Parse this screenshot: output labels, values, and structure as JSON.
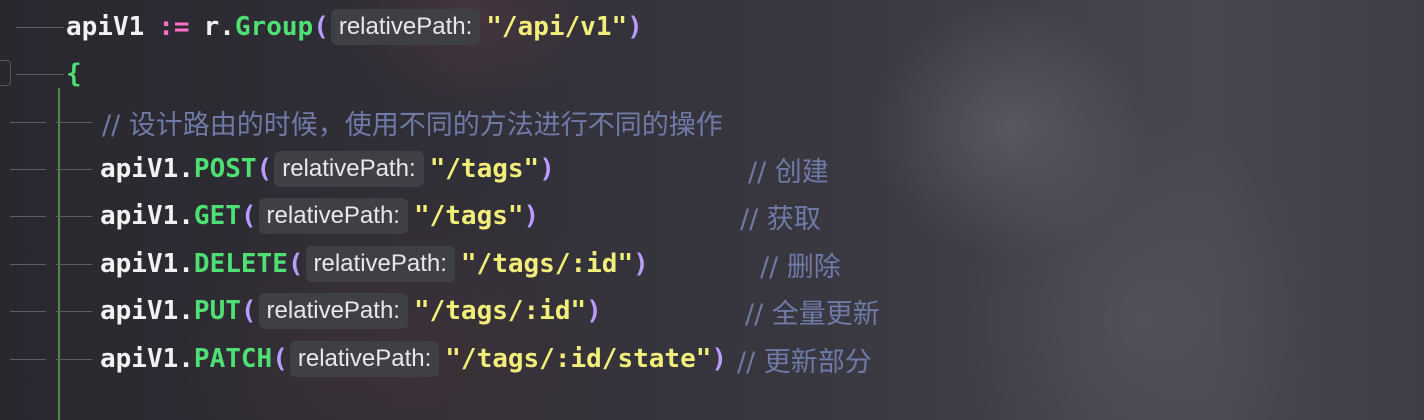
{
  "group_line": {
    "var": "apiV1",
    "op": ":=",
    "receiver": "r.",
    "func": "Group",
    "hint": "relativePath:",
    "arg": "\"/api/v1\""
  },
  "open_brace": "{",
  "comment_line": "// 设计路由的时候，使用不同的方法进行不同的操作",
  "routes": [
    {
      "receiver": "apiV1.",
      "method": "POST",
      "hint": "relativePath:",
      "path": "\"/tags\"",
      "comment": "// 创建"
    },
    {
      "receiver": "apiV1.",
      "method": "GET",
      "hint": "relativePath:",
      "path": "\"/tags\"",
      "comment": "// 获取"
    },
    {
      "receiver": "apiV1.",
      "method": "DELETE",
      "hint": "relativePath:",
      "path": "\"/tags/:id\"",
      "comment": "// 删除"
    },
    {
      "receiver": "apiV1.",
      "method": "PUT",
      "hint": "relativePath:",
      "path": "\"/tags/:id\"",
      "comment": "// 全量更新"
    },
    {
      "receiver": "apiV1.",
      "method": "PATCH",
      "hint": "relativePath:",
      "path": "\"/tags/:id/state\"",
      "comment": "// 更新部分"
    }
  ],
  "colors": {
    "identifier": "#f2f2f2",
    "operator": "#ff6ec7",
    "function": "#4fe073",
    "paren": "#b99cff",
    "string": "#f3ee7a",
    "comment": "#6f7aa6",
    "inlay_hint_bg": "#3f4046"
  }
}
